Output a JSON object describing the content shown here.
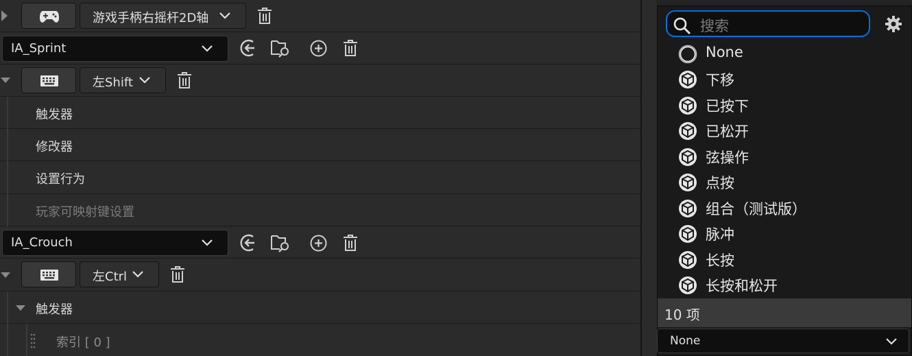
{
  "rows": {
    "gamepad_key": "游戏手柄右摇杆2D轴",
    "action1": "IA_Sprint",
    "key1": "左Shift",
    "triggers": "触发器",
    "modifiers": "修改器",
    "behavior": "设置行为",
    "player_mappable": "玩家可映射键设置",
    "action2": "IA_Crouch",
    "key2": "左Ctrl",
    "triggers2": "触发器",
    "index_label": "索引 [ 0 ]"
  },
  "menu": {
    "search_placeholder": "搜索",
    "items": [
      {
        "label": "None",
        "icon": "none-circle-icon"
      },
      {
        "label": "下移",
        "icon": "cube-icon"
      },
      {
        "label": "已按下",
        "icon": "cube-icon"
      },
      {
        "label": "已松开",
        "icon": "cube-icon"
      },
      {
        "label": "弦操作",
        "icon": "cube-icon"
      },
      {
        "label": "点按",
        "icon": "cube-icon"
      },
      {
        "label": "组合（测试版）",
        "icon": "cube-icon"
      },
      {
        "label": "脉冲",
        "icon": "cube-icon"
      },
      {
        "label": "长按",
        "icon": "cube-icon"
      },
      {
        "label": "长按和松开",
        "icon": "cube-icon"
      }
    ],
    "count": "10 项",
    "selected": "None"
  },
  "colors": {
    "accent": "#0070e0",
    "background": "#242424",
    "panel": "#1a1a1a"
  }
}
